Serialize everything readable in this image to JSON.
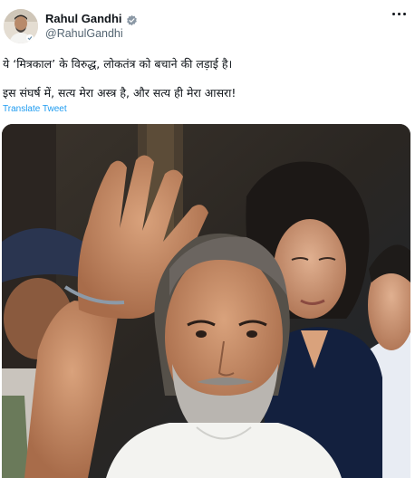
{
  "author": {
    "display_name": "Rahul Gandhi",
    "handle": "@RahulGandhi",
    "verified": true,
    "verified_color": "#8b98a5"
  },
  "tweet": {
    "line1": "ये ‘मित्रकाल’ के विरुद्ध, लोकतंत्र को बचाने की लड़ाई है।",
    "line2": "इस संघर्ष में, सत्य मेरा अस्त्र है, और सत्य ही मेरा आसरा!",
    "translate_label": "Translate Tweet"
  },
  "icons": {
    "verified": "verified-badge-icon",
    "more": "more-options-icon"
  },
  "colors": {
    "link": "#1d9bf0",
    "secondary_text": "#536471",
    "primary_text": "#0f1419"
  }
}
